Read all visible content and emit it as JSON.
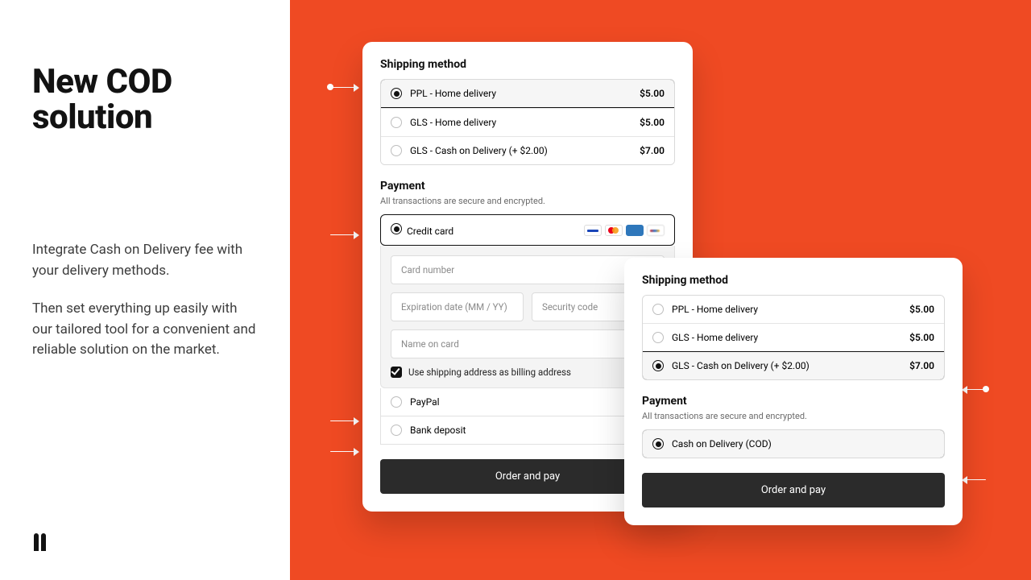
{
  "hero": {
    "title": "New COD solution",
    "p1": "Integrate Cash on Delivery fee with your delivery methods.",
    "p2": "Then set everything up easily with our tailored tool for a convenient and reliable solution on the market."
  },
  "cardA": {
    "shipping_title": "Shipping method",
    "shipping": [
      {
        "label": "PPL - Home delivery",
        "price": "$5.00",
        "selected": true
      },
      {
        "label": "GLS - Home delivery",
        "price": "$5.00",
        "selected": false
      },
      {
        "label": "GLS - Cash on Delivery (+ $2.00)",
        "price": "$7.00",
        "selected": false
      }
    ],
    "payment_title": "Payment",
    "payment_sub": "All transactions are secure and encrypted.",
    "credit_label": "Credit card",
    "fields": {
      "card_number": "Card number",
      "exp": "Expiration date (MM / YY)",
      "cvc": "Security code",
      "name": "Name on card"
    },
    "billing_same": "Use shipping address as billing address",
    "paypal": "PayPal",
    "bank": "Bank deposit",
    "cta": "Order and pay"
  },
  "cardB": {
    "shipping_title": "Shipping method",
    "shipping": [
      {
        "label": "PPL - Home delivery",
        "price": "$5.00",
        "selected": false
      },
      {
        "label": "GLS - Home delivery",
        "price": "$5.00",
        "selected": false
      },
      {
        "label": "GLS - Cash on Delivery (+ $2.00)",
        "price": "$7.00",
        "selected": true
      }
    ],
    "payment_title": "Payment",
    "payment_sub": "All transactions are secure and encrypted.",
    "cod_label": "Cash on Delivery (COD)",
    "cta": "Order and pay"
  }
}
